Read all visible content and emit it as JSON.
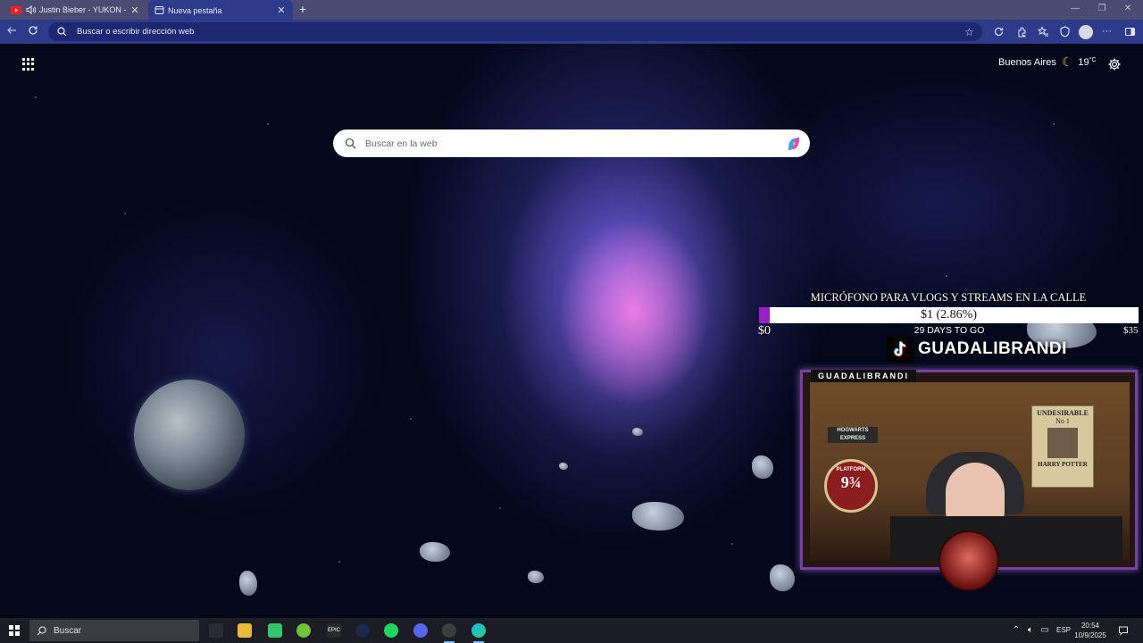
{
  "tabs": [
    {
      "title": "Justin Bieber - YUKON - You",
      "favicon": "youtube-icon",
      "audio": "speaker-icon"
    },
    {
      "title": "Nueva pestaña",
      "favicon": "newtab-page-icon"
    }
  ],
  "addressbar": {
    "placeholder": "Buscar o escribir dirección web"
  },
  "newtab": {
    "search_placeholder": "Buscar en la web",
    "weather_city": "Buenos Aires",
    "weather_temp": "19",
    "weather_unit": "°C",
    "weather_icon": "moon-icon"
  },
  "goal": {
    "title": "MICRÓFONO PARA VLOGS Y STREAMS EN LA CALLE",
    "amount": "$1 (2.86%)",
    "progress_percent": 2.86,
    "min": "$0",
    "max": "$35",
    "days_left": "29 DAYS TO GO"
  },
  "stream": {
    "handle": "GUADALIBRANDI",
    "cam_label": "GUADALIBRANDI",
    "sign_hogwarts": "HOGWARTS EXPRESS",
    "sign_platform": "PLATFORM",
    "sign_platform_number": "9¾",
    "poster_title": "UNDESIRABLE",
    "poster_no": "No 1",
    "poster_name": "HARRY POTTER"
  },
  "taskbar": {
    "search_placeholder": "Buscar",
    "language": "ESP",
    "time": "20:54",
    "date": "10/9/2025"
  },
  "colors": {
    "tab_strip": "#4b4b72",
    "toolbar": "#2d3c8a",
    "goal_fill": "#9b1fc5",
    "taskbar": "#1c1c24"
  }
}
